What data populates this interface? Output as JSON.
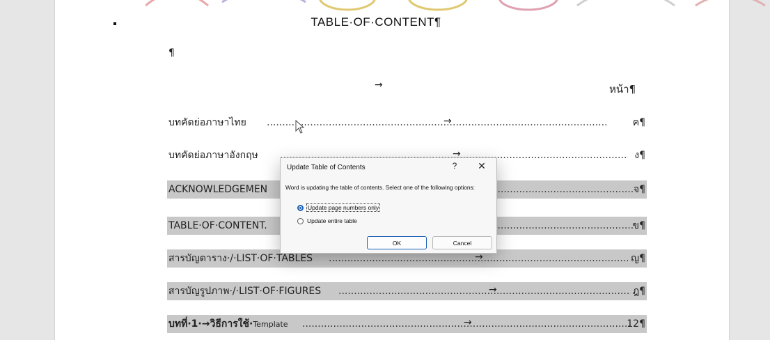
{
  "document": {
    "heading": "TABLE·OF·CONTENT¶",
    "empty_paragraph": "¶",
    "page_column_arrow": "→",
    "page_column_label": "หน้า¶",
    "entries": [
      {
        "label": "บทคัดย่อภาษาไทย",
        "arrow": "→",
        "page": "ค¶",
        "shaded": false
      },
      {
        "label": "บทคัดย่อภาษาอังกฤษ",
        "arrow": "→",
        "page": "ง¶",
        "shaded": false
      },
      {
        "label": "ACKNOWLEDGEMEN",
        "arrow": "",
        "page": "จ¶",
        "shaded": true
      },
      {
        "label": "TABLE·OF·CONTENT.",
        "arrow": "",
        "page": "ข¶",
        "shaded": true
      },
      {
        "label": "สารบัญตาราง·/·LIST·OF·TABLES",
        "arrow": "→",
        "page": "ญ¶",
        "shaded": true
      },
      {
        "label": "สารบัญรูปภาพ·/·LIST·OF·FIGURES",
        "arrow": "→",
        "page": "ฎ¶",
        "shaded": true
      },
      {
        "label_bold": "บทที่·1·→วิธีการใช้·",
        "label_small": "Template",
        "arrow": "→",
        "page": "12¶",
        "shaded": true
      }
    ]
  },
  "dialog": {
    "title": "Update Table of Contents",
    "help": "?",
    "close": "✕",
    "message": "Word is updating the table of contents.  Select one of the following options:",
    "options": [
      {
        "label": "Update page numbers only",
        "selected": true
      },
      {
        "label": "Update entire table",
        "selected": false
      }
    ],
    "ok_label": "OK",
    "cancel_label": "Cancel"
  },
  "colors": {
    "accent": "#1a5fb4",
    "shading": "#c8c8c8"
  }
}
